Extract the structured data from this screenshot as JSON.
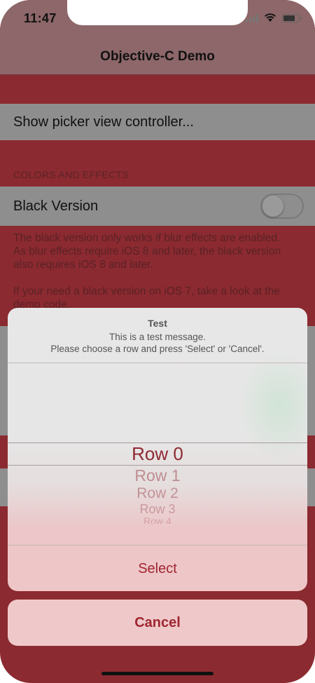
{
  "status_bar": {
    "time": "11:47"
  },
  "navbar": {
    "title": "Objective-C Demo"
  },
  "list": {
    "show_picker_label": "Show picker view controller...",
    "section_header": "COLORS AND EFFECTS",
    "black_version_label": "Black Version",
    "black_version_on": false,
    "footer_line1": "The black version only works if blur effects are enabled.",
    "footer_line2": "As blur effects require iOS 8 and later, the black version",
    "footer_line3": "also requires iOS 8 and later.",
    "footer_line4": "If your need a black version on iOS 7, take a look at the",
    "footer_line5": "demo code."
  },
  "sheet": {
    "title": "Test",
    "message_line1": "This is a test message.",
    "message_line2": "Please choose a row and press 'Select' or 'Cancel'.",
    "rows": [
      "Row 0",
      "Row 1",
      "Row 2",
      "Row 3",
      "Row 4"
    ],
    "selected_row": "Row 0",
    "select_label": "Select",
    "cancel_label": "Cancel"
  },
  "colors": {
    "accent": "#a02631",
    "background": "#8b2a30"
  }
}
